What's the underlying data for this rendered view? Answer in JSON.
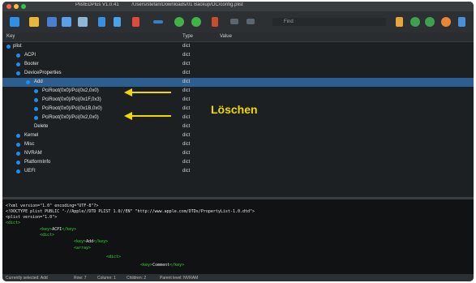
{
  "window": {
    "title": "PlistEDPlus  V1.0.41",
    "path": "/Users/stefan/Downloads/01 Backup/OC/config.plist"
  },
  "toolbar": {
    "find_placeholder": "Find"
  },
  "columns": {
    "key": "Key",
    "type": "Type",
    "value": "Value"
  },
  "tree": [
    {
      "label": "plist",
      "type": "dict"
    },
    {
      "label": "ACPI",
      "type": "dict"
    },
    {
      "label": "Booter",
      "type": "dict"
    },
    {
      "label": "DeviceProperties",
      "type": "dict"
    },
    {
      "label": "Add",
      "type": "dict"
    },
    {
      "label": "PciRoot(0x0)/Pci(0x2,0x0)",
      "type": "dict"
    },
    {
      "label": "PciRoot(0x0)/Pci(0x1F,0x3)",
      "type": "dict"
    },
    {
      "label": "PciRoot(0x0)/Pci(0x1B,0x0)",
      "type": "dict"
    },
    {
      "label": "PciRoot(0x0)/Pci(0x2,0x0)",
      "type": "dict"
    },
    {
      "label": "Delete",
      "type": "dict"
    },
    {
      "label": "Kernel",
      "type": "dict"
    },
    {
      "label": "Misc",
      "type": "dict"
    },
    {
      "label": "NVRAM",
      "type": "dict"
    },
    {
      "label": "PlatformInfo",
      "type": "dict"
    },
    {
      "label": "UEFI",
      "type": "dict"
    }
  ],
  "annotation": {
    "text": "Löschen",
    "color": "#f0d800"
  },
  "code": {
    "line1": "<?xml version=\"1.0\" encoding=\"UTF-8\"?>",
    "line2": "<!DOCTYPE plist PUBLIC \"-//Apple//DTD PLIST 1.0//EN\" \"http://www.apple.com/DTDs/PropertyList-1.0.dtd\">",
    "line3": "<plist version=\"1.0\">",
    "line4": "<dict>",
    "line5_tag1": "<key>",
    "line5_text": "ACPI",
    "line5_tag2": "</key>",
    "line6": "<dict>",
    "line7_tag1": "<key>",
    "line7_text": "Add",
    "line7_tag2": "</key>",
    "line8": "<array>",
    "line9": "<dict>",
    "line10_tag1": "<key>",
    "line10_text": "Comment",
    "line10_tag2": "</key>"
  },
  "status": {
    "selected": "Currently selected: Add",
    "row": "Row: 7",
    "column": "Column: 1",
    "children": "Children: 2",
    "parent": "Parent level: NVRAM"
  },
  "colors": {
    "accent": "#1c8df2",
    "selection": "#2c5f8f",
    "xml_tag": "#36d635"
  }
}
